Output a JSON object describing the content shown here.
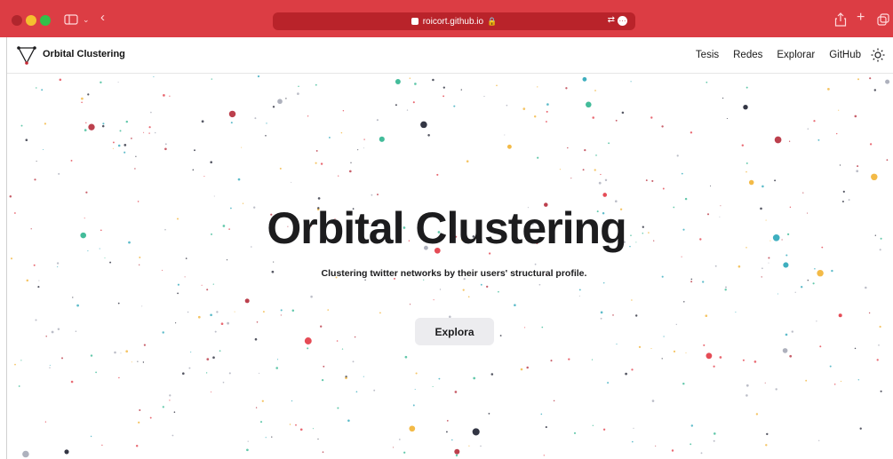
{
  "browser": {
    "url": "roicort.github.io",
    "accent_color": "#dc3d44"
  },
  "site": {
    "brand": "Orbital Clustering",
    "nav": [
      "Tesis",
      "Redes",
      "Explorar",
      "GitHub"
    ],
    "theme_toggle_icon": "sun-icon"
  },
  "hero": {
    "title": "Orbital Clustering",
    "subtitle": "Clustering twitter networks by their users' structural profile.",
    "cta_label": "Explora"
  },
  "palette": {
    "dot_colors": [
      "#e23844",
      "#f2b233",
      "#2aa6b8",
      "#a5a8b6",
      "#1d2030",
      "#2fb58f",
      "#b52b3a"
    ]
  }
}
